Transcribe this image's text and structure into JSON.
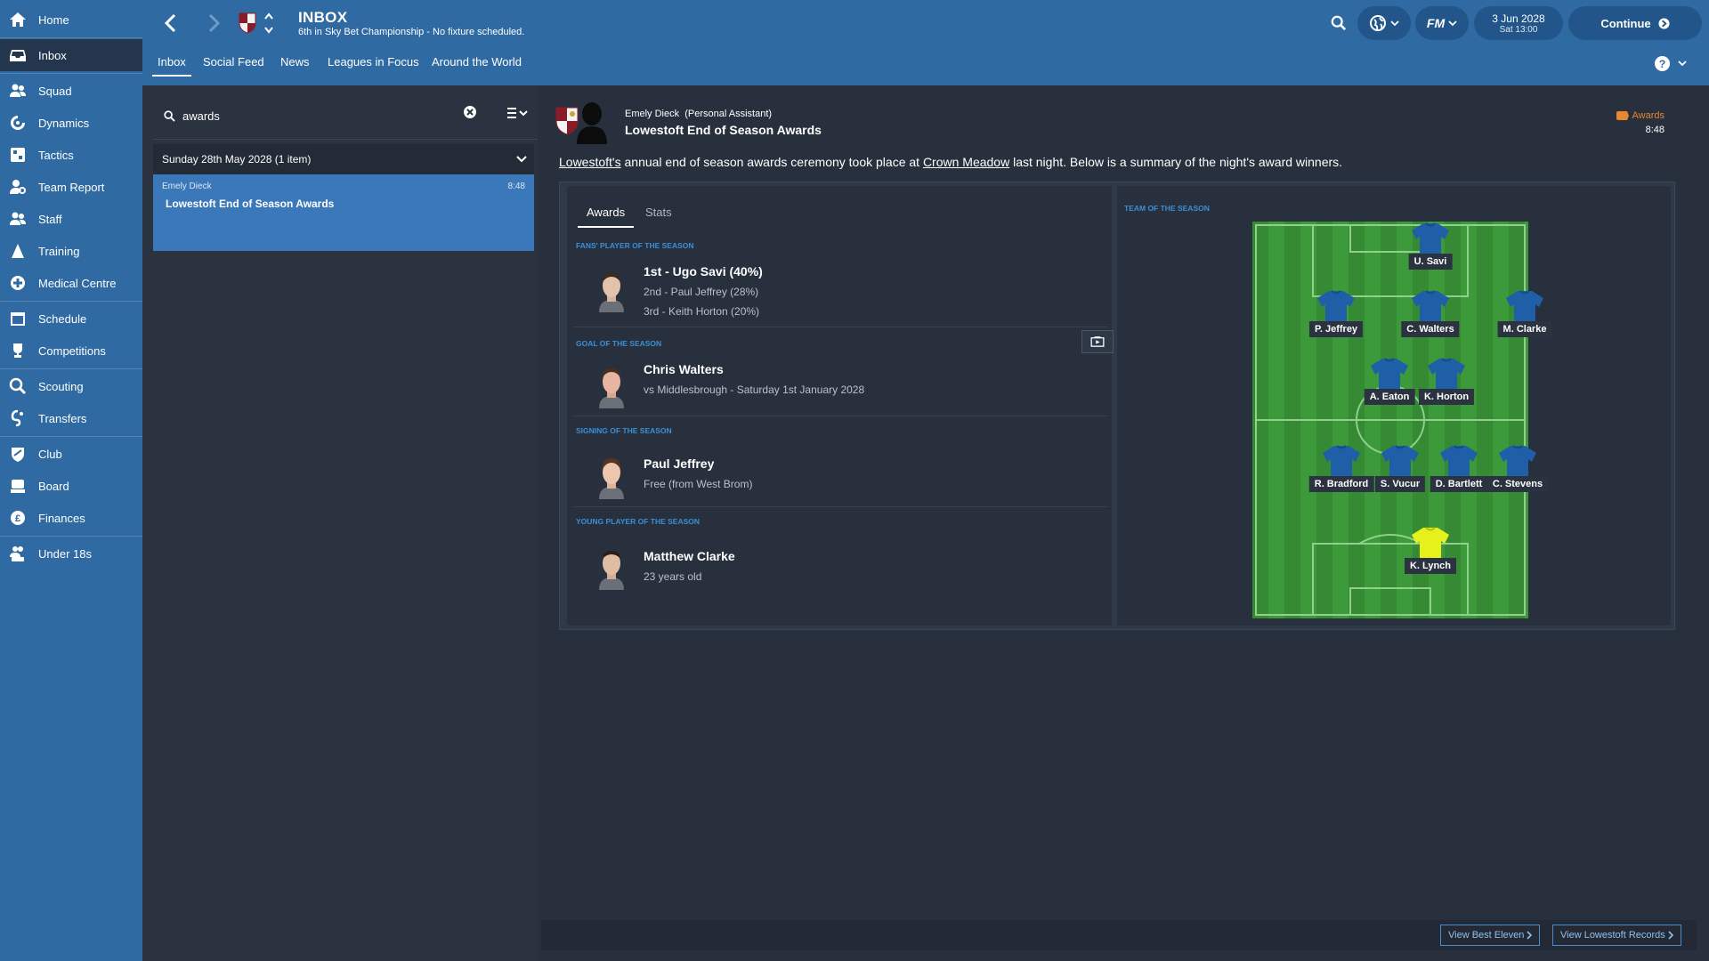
{
  "sidebar": {
    "items": [
      {
        "label": "Home",
        "icon": "home-icon"
      },
      {
        "label": "Inbox",
        "icon": "inbox-icon",
        "active": true
      },
      {
        "label": "Squad",
        "icon": "squad-icon"
      },
      {
        "label": "Dynamics",
        "icon": "dynamics-icon"
      },
      {
        "label": "Tactics",
        "icon": "tactics-icon"
      },
      {
        "label": "Team Report",
        "icon": "team-report-icon"
      },
      {
        "label": "Staff",
        "icon": "staff-icon"
      },
      {
        "label": "Training",
        "icon": "training-icon"
      },
      {
        "label": "Medical Centre",
        "icon": "medical-icon"
      },
      {
        "label": "Schedule",
        "icon": "schedule-icon"
      },
      {
        "label": "Competitions",
        "icon": "trophy-icon"
      },
      {
        "label": "Scouting",
        "icon": "scouting-icon"
      },
      {
        "label": "Transfers",
        "icon": "transfers-icon"
      },
      {
        "label": "Club",
        "icon": "club-icon"
      },
      {
        "label": "Board",
        "icon": "board-icon"
      },
      {
        "label": "Finances",
        "icon": "finances-icon"
      },
      {
        "label": "Under 18s",
        "icon": "under18s-icon"
      }
    ]
  },
  "header": {
    "title": "INBOX",
    "subtitle": "6th in Sky Bet Championship - No fixture scheduled.",
    "date": "3 Jun 2028",
    "time": "Sat 13:00",
    "continue_label": "Continue",
    "fm_label": "FM",
    "tabs": [
      {
        "label": "Inbox",
        "active": true
      },
      {
        "label": "Social Feed"
      },
      {
        "label": "News"
      },
      {
        "label": "Leagues in Focus"
      },
      {
        "label": "Around the World"
      }
    ]
  },
  "inbox_list": {
    "search_value": "awards",
    "group_label": "Sunday 28th May 2028 (1 item)",
    "items": [
      {
        "sender": "Emely Dieck",
        "time": "8:48",
        "subject": "Lowestoft End of Season Awards"
      }
    ]
  },
  "message": {
    "sender_name": "Emely Dieck",
    "sender_role": "(Personal Assistant)",
    "title": "Lowestoft End of Season Awards",
    "tag": "Awards",
    "time": "8:48",
    "intro_club": "Lowestoft's",
    "intro_part1": " annual end of season awards ceremony took place at ",
    "intro_venue": "Crown Meadow",
    "intro_part2": " last night. Below is a summary of the night's award winners.",
    "tabs": [
      "Awards",
      "Stats"
    ],
    "awards": [
      {
        "category": "Fans' Player of the Season",
        "winner": "1st - Ugo Savi (40%)",
        "lines": [
          "2nd - Paul Jeffrey (28%)",
          "3rd - Keith Horton (20%)"
        ]
      },
      {
        "category": "Goal of the Season",
        "winner": "Chris Walters",
        "lines": [
          "vs Middlesbrough - Saturday 1st January 2028"
        ]
      },
      {
        "category": "Signing of the Season",
        "winner": "Paul Jeffrey",
        "lines": [
          "Free (from West Brom)"
        ]
      },
      {
        "category": "Young Player of the Season",
        "winner": "Matthew Clarke",
        "lines": [
          "23 years old"
        ]
      }
    ],
    "team_of_season_title": "Team of the Season",
    "team": [
      {
        "name": "U. Savi",
        "role": "striker"
      },
      {
        "name": "P. Jeffrey",
        "role": "winger"
      },
      {
        "name": "C. Walters",
        "role": "attacking-mid"
      },
      {
        "name": "M. Clarke",
        "role": "winger"
      },
      {
        "name": "A. Eaton",
        "role": "central-mid"
      },
      {
        "name": "K. Horton",
        "role": "central-mid"
      },
      {
        "name": "R. Bradford",
        "role": "defender"
      },
      {
        "name": "S. Vucur",
        "role": "defender"
      },
      {
        "name": "D. Bartlett",
        "role": "defender"
      },
      {
        "name": "C. Stevens",
        "role": "defender"
      },
      {
        "name": "K. Lynch",
        "role": "goalkeeper"
      }
    ]
  },
  "footer": {
    "best_eleven": "View Best Eleven",
    "records": "View Lowestoft Records"
  },
  "colors": {
    "sidebar": "#2f6aa3",
    "header": "#2f6aa3",
    "background": "#2b3340",
    "selected_item": "#3a78b9",
    "accent_blue": "#3a8fd9",
    "tag_orange": "#e8872f",
    "pitch_green": "#3d9a3a",
    "shirt_blue": "#1f5fa8",
    "keeper_yellow": "#e6f01a"
  }
}
